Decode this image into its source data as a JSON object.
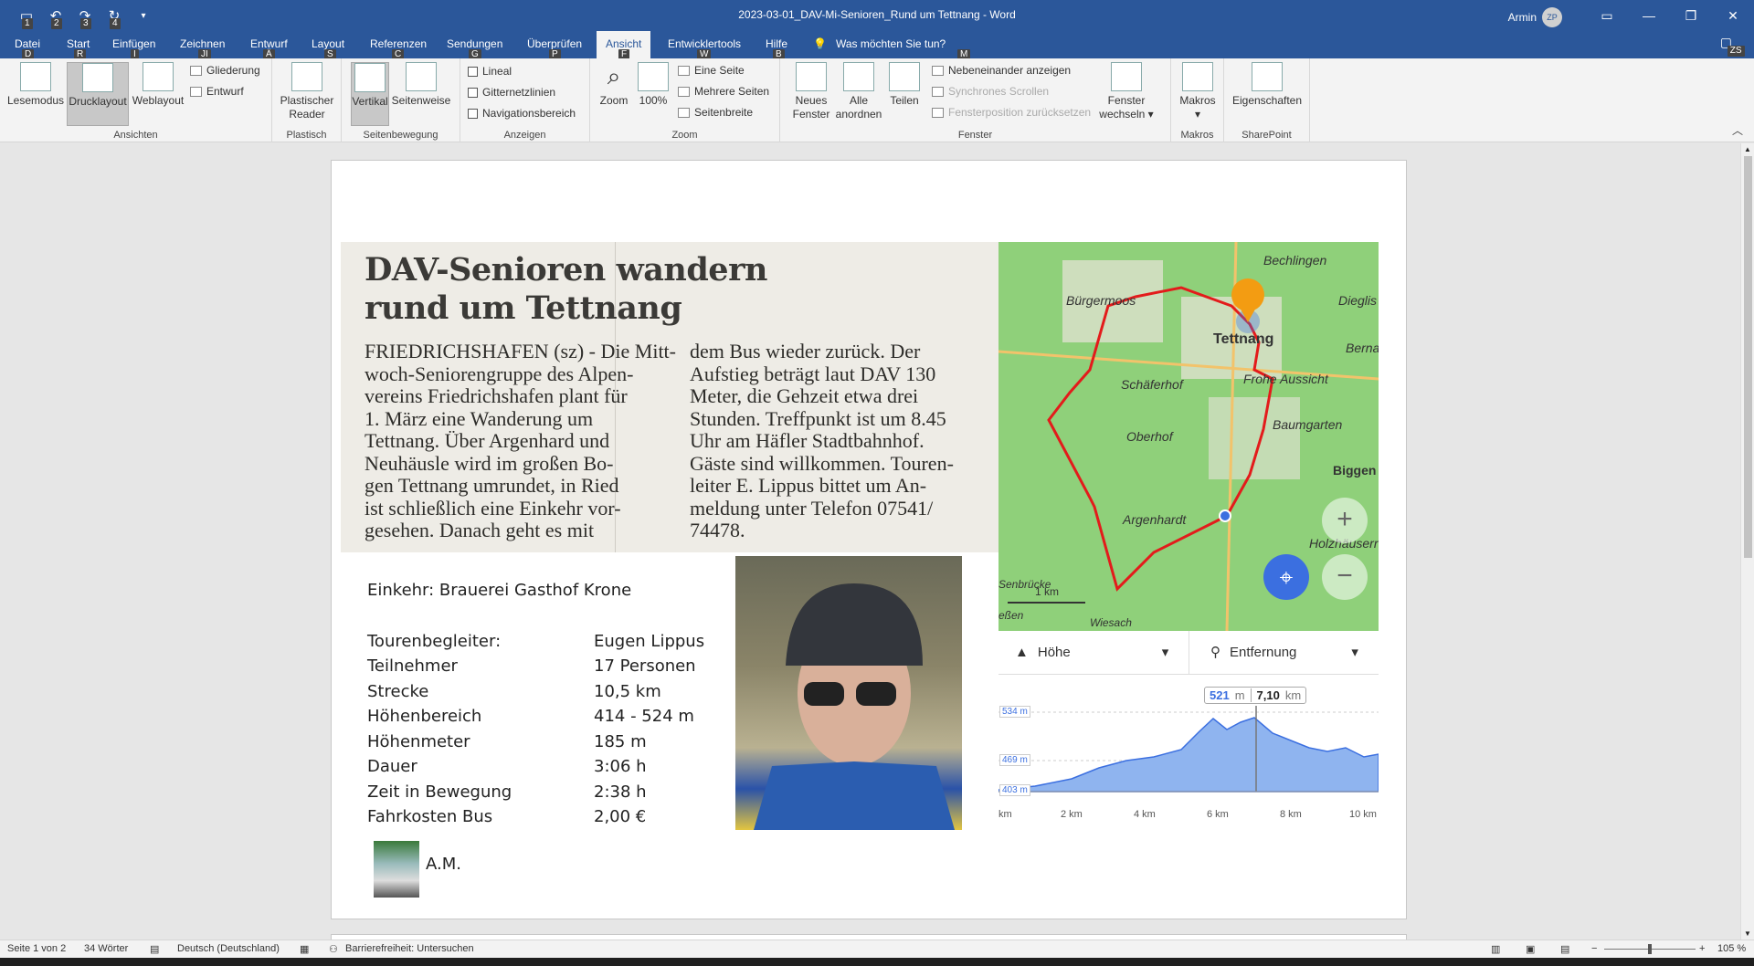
{
  "titlebar": {
    "document_title": "2023-03-01_DAV-Mi-Senioren_Rund um Tettnang  -  Word",
    "user_name": "Armin",
    "user_initials": "ZP",
    "qat_keytips": [
      "1",
      "2",
      "3",
      "4"
    ],
    "search_keytip": "ZS"
  },
  "menu": {
    "tabs": [
      "Datei",
      "Start",
      "Einfügen",
      "Zeichnen",
      "Entwurf",
      "Layout",
      "Referenzen",
      "Sendungen",
      "Überprüfen",
      "Ansicht",
      "Entwicklertools",
      "Hilfe"
    ],
    "keytips": [
      "D",
      "R",
      "I",
      "JI",
      "Ä",
      "S",
      "C",
      "G",
      "P",
      "F",
      "W",
      "B"
    ],
    "active_tab": "Ansicht",
    "tell_me": "Was möchten Sie tun?",
    "tell_me_keytip": "M"
  },
  "ribbon": {
    "ansichten": {
      "label": "Ansichten",
      "lesemodus": "Lesemodus",
      "drucklayout": "Drucklayout",
      "weblayout": "Weblayout",
      "gliederung": "Gliederung",
      "entwurf": "Entwurf"
    },
    "plastisch": {
      "label": "Plastisch",
      "reader_line1": "Plastischer",
      "reader_line2": "Reader"
    },
    "seitenbewegung": {
      "label": "Seitenbewegung",
      "vertikal": "Vertikal",
      "seitenweise": "Seitenweise"
    },
    "anzeigen": {
      "label": "Anzeigen",
      "lineal": "Lineal",
      "gitternetzlinien": "Gitternetzlinien",
      "navigationsbereich": "Navigationsbereich"
    },
    "zoom": {
      "label": "Zoom",
      "zoom": "Zoom",
      "hundert": "100%",
      "eine_seite": "Eine Seite",
      "mehrere_seiten": "Mehrere Seiten",
      "seitenbreite": "Seitenbreite"
    },
    "fenster": {
      "label": "Fenster",
      "neues_line1": "Neues",
      "neues_line2": "Fenster",
      "alle_line1": "Alle",
      "alle_line2": "anordnen",
      "teilen": "Teilen",
      "nebeneinander": "Nebeneinander anzeigen",
      "synchrones": "Synchrones Scrollen",
      "fensterposition": "Fensterposition zurücksetzen",
      "wechseln_line1": "Fenster",
      "wechseln_line2": "wechseln"
    },
    "makros": {
      "label": "Makros",
      "makros": "Makros"
    },
    "sharepoint": {
      "label": "SharePoint",
      "eigenschaften": "Eigenschaften"
    }
  },
  "clipping": {
    "headline_line1": "DAV-Senioren wandern",
    "headline_line2": "rund um Tettnang",
    "col1": [
      "FRIEDRICHSHAFEN (sz) - Die Mitt-",
      "woch-Seniorengruppe des Alpen-",
      "vereins Friedrichshafen plant für",
      "1. März eine Wanderung um",
      "Tettnang. Über Argenhard und",
      "Neuhäusle wird im großen Bo-",
      "gen Tettnang umrundet, in Ried",
      "ist schließlich eine Einkehr vor-",
      "gesehen. Danach geht es mit"
    ],
    "col2": [
      "dem Bus wieder zurück. Der",
      "Aufstieg beträgt laut DAV 130",
      "Meter, die Gehzeit etwa drei",
      "Stunden. Treffpunkt ist um 8.45",
      "Uhr am Häfler Stadtbahnhof.",
      "Gäste sind willkommen. Touren-",
      "leiter E. Lippus bittet um An-",
      "meldung unter Telefon 07541/",
      "74478."
    ]
  },
  "map": {
    "labels": [
      "Bechlingen",
      "Bürgermoos",
      "Dieglis",
      "Tettnang",
      "Berna",
      "Schäferhof",
      "Frohe Aussicht",
      "Oberhof",
      "Baumgarten",
      "Biggen",
      "Argenhardt",
      "Holzhäuserr",
      "Senbrücke",
      "eßen",
      "Wiesach"
    ],
    "scale": "1 km",
    "zoom_in": "+",
    "zoom_out": "−"
  },
  "profile": {
    "left_dropdown": "Höhe",
    "right_dropdown": "Entfernung",
    "tooltip_height": "521",
    "tooltip_height_unit": "m",
    "tooltip_distance": "7,10",
    "tooltip_distance_unit": "km",
    "y_labels": [
      "534 m",
      "469 m",
      "403 m"
    ],
    "x_labels": [
      "km",
      "2 km",
      "4 km",
      "6 km",
      "8 km",
      "10 km"
    ]
  },
  "details": {
    "einkehr": "Einkehr: Brauerei Gasthof Krone",
    "rows": [
      {
        "label": "Tourenbegleiter:",
        "value": "Eugen Lippus"
      },
      {
        "label": "Teilnehmer",
        "value": "17 Personen"
      },
      {
        "label": "Strecke",
        "value": "10,5 km"
      },
      {
        "label": "Höhenbereich",
        "value": "414 - 524 m"
      },
      {
        "label": "Höhenmeter",
        "value": "185 m"
      },
      {
        "label": "Dauer",
        "value": "3:06 h"
      },
      {
        "label": "Zeit in Bewegung",
        "value": "2:38 h"
      },
      {
        "label": "Fahrkosten Bus",
        "value": "2,00 €"
      }
    ],
    "signature": "A.M."
  },
  "statusbar": {
    "page": "Seite 1 von 2",
    "words": "34 Wörter",
    "language": "Deutsch (Deutschland)",
    "accessibility": "Barrierefreiheit: Untersuchen",
    "zoom": "105 %"
  }
}
